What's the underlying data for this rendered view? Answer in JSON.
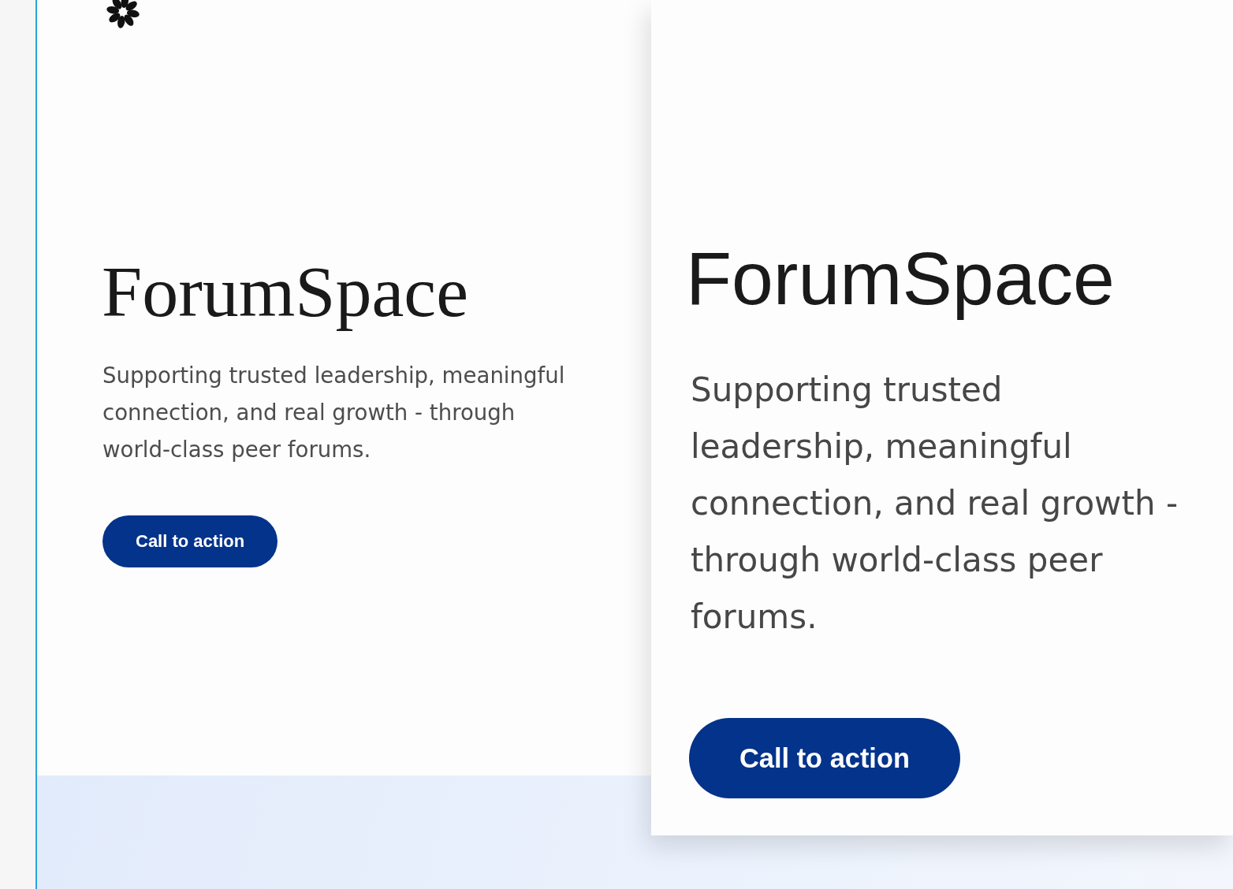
{
  "panels": [
    {
      "kind": "serif",
      "title": "ForumSpace",
      "description": "Supporting trusted leadership, meaningful connection, and real growth - through world-class peer forums.",
      "button": "Call to action"
    },
    {
      "kind": "sans",
      "title": "ForumSpace",
      "description": "Supporting trusted leadership, meaningful connection, and real growth - through world-class peer forums.",
      "button": "Call to action"
    }
  ]
}
